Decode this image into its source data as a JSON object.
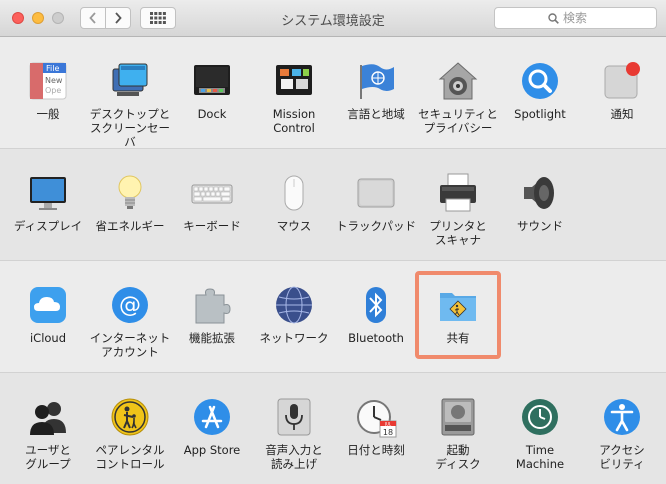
{
  "window": {
    "title": "システム環境設定"
  },
  "search": {
    "placeholder": "検索"
  },
  "sections": [
    {
      "items": [
        {
          "label": "一般"
        },
        {
          "label": "デスクトップと\nスクリーンセーバ"
        },
        {
          "label": "Dock"
        },
        {
          "label": "Mission\nControl"
        },
        {
          "label": "言語と地域"
        },
        {
          "label": "セキュリティと\nプライバシー"
        },
        {
          "label": "Spotlight"
        },
        {
          "label": "通知"
        }
      ]
    },
    {
      "items": [
        {
          "label": "ディスプレイ"
        },
        {
          "label": "省エネルギー"
        },
        {
          "label": "キーボード"
        },
        {
          "label": "マウス"
        },
        {
          "label": "トラックパッド"
        },
        {
          "label": "プリンタと\nスキャナ"
        },
        {
          "label": "サウンド"
        }
      ]
    },
    {
      "items": [
        {
          "label": "iCloud"
        },
        {
          "label": "インターネット\nアカウント"
        },
        {
          "label": "機能拡張"
        },
        {
          "label": "ネットワーク"
        },
        {
          "label": "Bluetooth"
        },
        {
          "label": "共有"
        }
      ]
    },
    {
      "items": [
        {
          "label": "ユーザと\nグループ"
        },
        {
          "label": "ペアレンタル\nコントロール"
        },
        {
          "label": "App Store"
        },
        {
          "label": "音声入力と\n読み上げ"
        },
        {
          "label": "日付と時刻"
        },
        {
          "label": "起動\nディスク"
        },
        {
          "label": "Time\nMachine"
        },
        {
          "label": "アクセシ\nビリティ"
        }
      ]
    }
  ],
  "icon_text": {
    "general_file": "File",
    "general_new": "New",
    "general_open": "Ope",
    "calendar_month": "JUL",
    "calendar_day": "18"
  },
  "highlighted_item": "共有"
}
